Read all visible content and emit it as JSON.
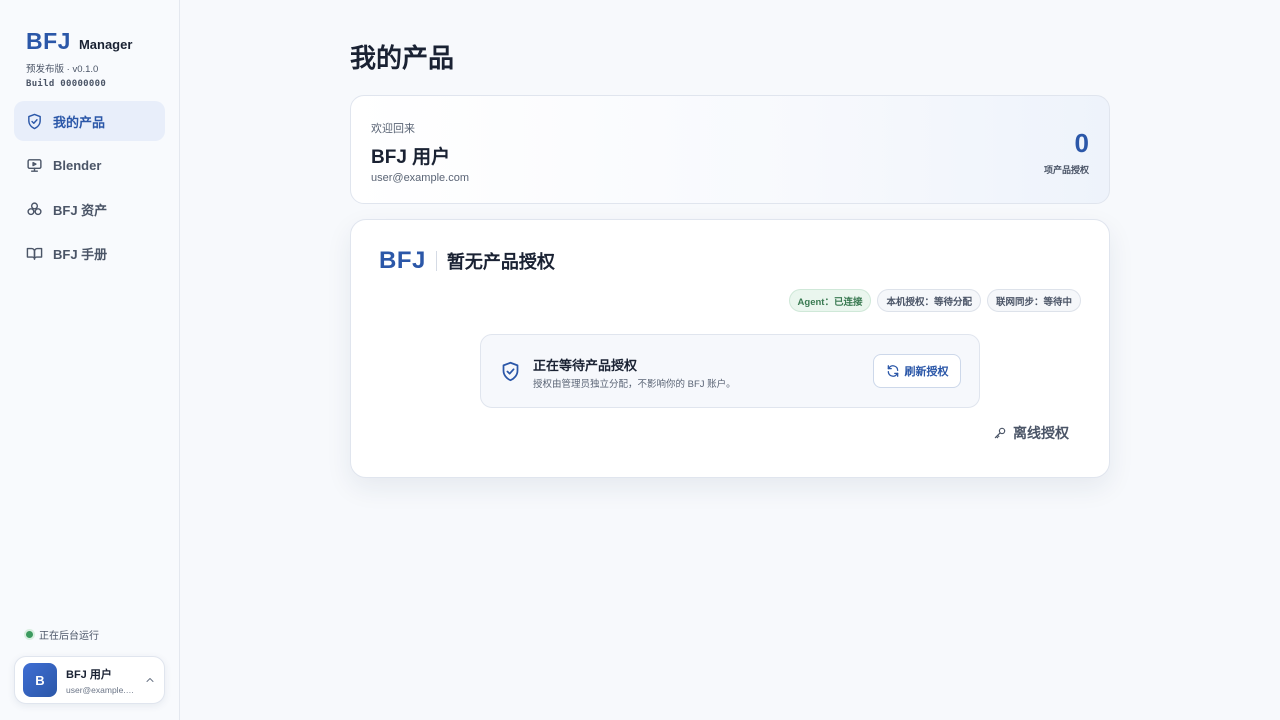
{
  "sidebar": {
    "brand_logo": "BFJ",
    "brand_sub": "Manager",
    "version": "预发布版 · v0.1.0",
    "build": "Build 00000000",
    "items": [
      {
        "label": "我的产品",
        "icon": "shield-check-icon",
        "active": true
      },
      {
        "label": "Blender",
        "icon": "monitor-play-icon",
        "active": false
      },
      {
        "label": "BFJ 资产",
        "icon": "boxes-icon",
        "active": false
      },
      {
        "label": "BFJ 手册",
        "icon": "book-open-icon",
        "active": false
      }
    ],
    "status_text": "正在后台运行",
    "status_color": "#3c9a5f",
    "user": {
      "avatar_letter": "B",
      "name": "BFJ 用户",
      "email": "user@example.com"
    }
  },
  "main": {
    "page_title": "我的产品",
    "welcome": {
      "hello": "欢迎回来",
      "name": "BFJ 用户",
      "email": "user@example.com",
      "count": "0",
      "count_label": "项产品授权"
    },
    "card": {
      "logo": "BFJ",
      "title": "暂无产品授权",
      "pills": [
        {
          "label": "Agent：已连接",
          "state": "ok"
        },
        {
          "label": "本机授权：等待分配",
          "state": "neutral"
        },
        {
          "label": "联网同步：等待中",
          "state": "neutral"
        }
      ],
      "waiting_title": "正在等待产品授权",
      "waiting_desc": "授权由管理员独立分配，不影响你的 BFJ 账户。",
      "refresh_label": "刷新授权",
      "offline_label": "离线授权"
    }
  },
  "colors": {
    "accent": "#2b57a8",
    "active_bg": "#e8eefa",
    "ok_green": "#3a7a52"
  }
}
